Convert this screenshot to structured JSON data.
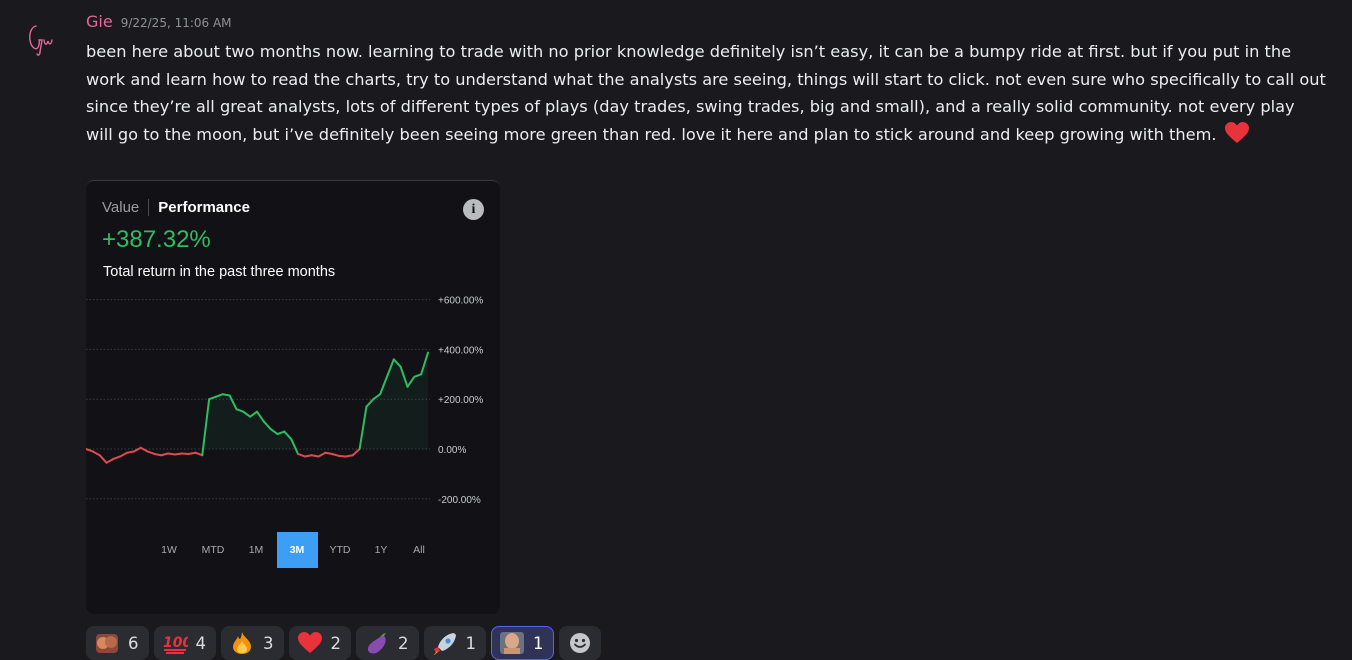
{
  "message": {
    "username": "Gie",
    "timestamp": "9/22/25, 11:06 AM",
    "text": "been here about two months now. learning to trade with no prior knowledge definitely isn’t easy, it can be a bumpy ride at first. but if you put in the work and learn how to read the charts, try to understand what the analysts are seeing, things will start to click. not even sure who specifically to call out since they’re all great analysts, lots of different types of plays (day trades, swing trades, big and small), and a really solid community. not every play will go to the moon, but i’ve definitely been seeing more green than red. love it here and plan to stick around and keep growing with them.",
    "trailing_emoji": "red-heart-emoji"
  },
  "card": {
    "tab_value": "Value",
    "tab_performance": "Performance",
    "performance_value": "+387.32%",
    "caption": "Total return in the past three months",
    "info_icon": "i",
    "range_buttons": [
      "1W",
      "MTD",
      "1M",
      "3M",
      "YTD",
      "1Y",
      "All"
    ],
    "active_range": "3M"
  },
  "chart_data": {
    "type": "line",
    "title": "",
    "xlabel": "",
    "ylabel": "",
    "ylim": [
      -250,
      600
    ],
    "y_ticks": [
      "+600.00%",
      "+400.00%",
      "+200.00%",
      "0.00%",
      "-200.00%"
    ],
    "y_tick_values": [
      600,
      400,
      200,
      0,
      -200
    ],
    "grid": true,
    "colors": {
      "gain": "#2ebd63",
      "loss": "#e04a4f"
    },
    "series": [
      {
        "values": [
          0,
          -10,
          -25,
          -55,
          -40,
          -30,
          -15,
          -10,
          5,
          -10,
          -20,
          -25,
          -18,
          -22,
          -18,
          -20,
          -15,
          -25,
          200,
          210,
          220,
          215,
          160,
          150,
          130,
          150,
          110,
          80,
          60,
          70,
          40,
          -20,
          -30,
          -25,
          -30,
          -15,
          -20,
          -28,
          -30,
          -25,
          0,
          170,
          200,
          220,
          290,
          360,
          330,
          250,
          290,
          300,
          387
        ]
      }
    ]
  },
  "reactions": [
    {
      "emoji": "kissing-faces-emoji",
      "count": "6",
      "me": false
    },
    {
      "emoji": "hundred-points-emoji",
      "count": "4",
      "me": false
    },
    {
      "emoji": "fire-emoji",
      "count": "3",
      "me": false
    },
    {
      "emoji": "red-heart-emoji",
      "count": "2",
      "me": false
    },
    {
      "emoji": "eggplant-emoji",
      "count": "2",
      "me": false
    },
    {
      "emoji": "rocket-emoji",
      "count": "1",
      "me": false
    },
    {
      "emoji": "custom-face-emoji",
      "count": "1",
      "me": true
    }
  ]
}
